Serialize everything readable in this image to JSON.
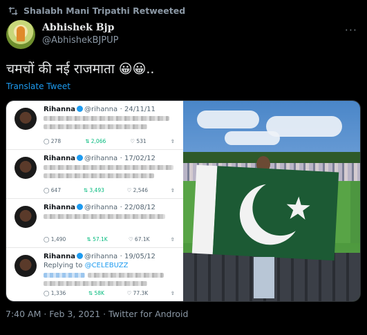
{
  "retweet_bar": {
    "text": "Shalabh Mani Tripathi Retweeted"
  },
  "author": {
    "name": "Abhishek Bjp",
    "handle": "@AbhishekBJPUP"
  },
  "tweet": {
    "text": "चमचों की नई राजमाता 😀😀..",
    "translate_label": "Translate Tweet"
  },
  "embedded_tweets": [
    {
      "name": "Rihanna",
      "handle": "@rihanna",
      "date": "· 24/11/11",
      "replying_to": "",
      "replying_handle": "",
      "counts": {
        "reply": "278",
        "retweet": "2,066",
        "like": "531"
      }
    },
    {
      "name": "Rihanna",
      "handle": "@rihanna",
      "date": "· 17/02/12",
      "replying_to": "",
      "replying_handle": "",
      "counts": {
        "reply": "647",
        "retweet": "3,493",
        "like": "2,546"
      }
    },
    {
      "name": "Rihanna",
      "handle": "@rihanna",
      "date": "· 22/08/12",
      "replying_to": "",
      "replying_handle": "",
      "counts": {
        "reply": "1,490",
        "retweet": "57.1K",
        "like": "67.1K"
      }
    },
    {
      "name": "Rihanna",
      "handle": "@rihanna",
      "date": "· 19/05/12",
      "replying_to": "Replying to",
      "replying_handle": "@CELEBUZZ",
      "counts": {
        "reply": "1,336",
        "retweet": "58K",
        "like": "77.3K"
      }
    }
  ],
  "footer": {
    "timestamp": "7:40 AM · Feb 3, 2021 · Twitter for Android"
  },
  "colors": {
    "accent": "#1d9bf0",
    "retweet_green": "#00ba7c",
    "flag_green": "#1c5a34"
  },
  "icons": [
    "retweet-icon",
    "more-icon",
    "reply-icon",
    "like-icon",
    "share-icon",
    "verified-icon"
  ]
}
